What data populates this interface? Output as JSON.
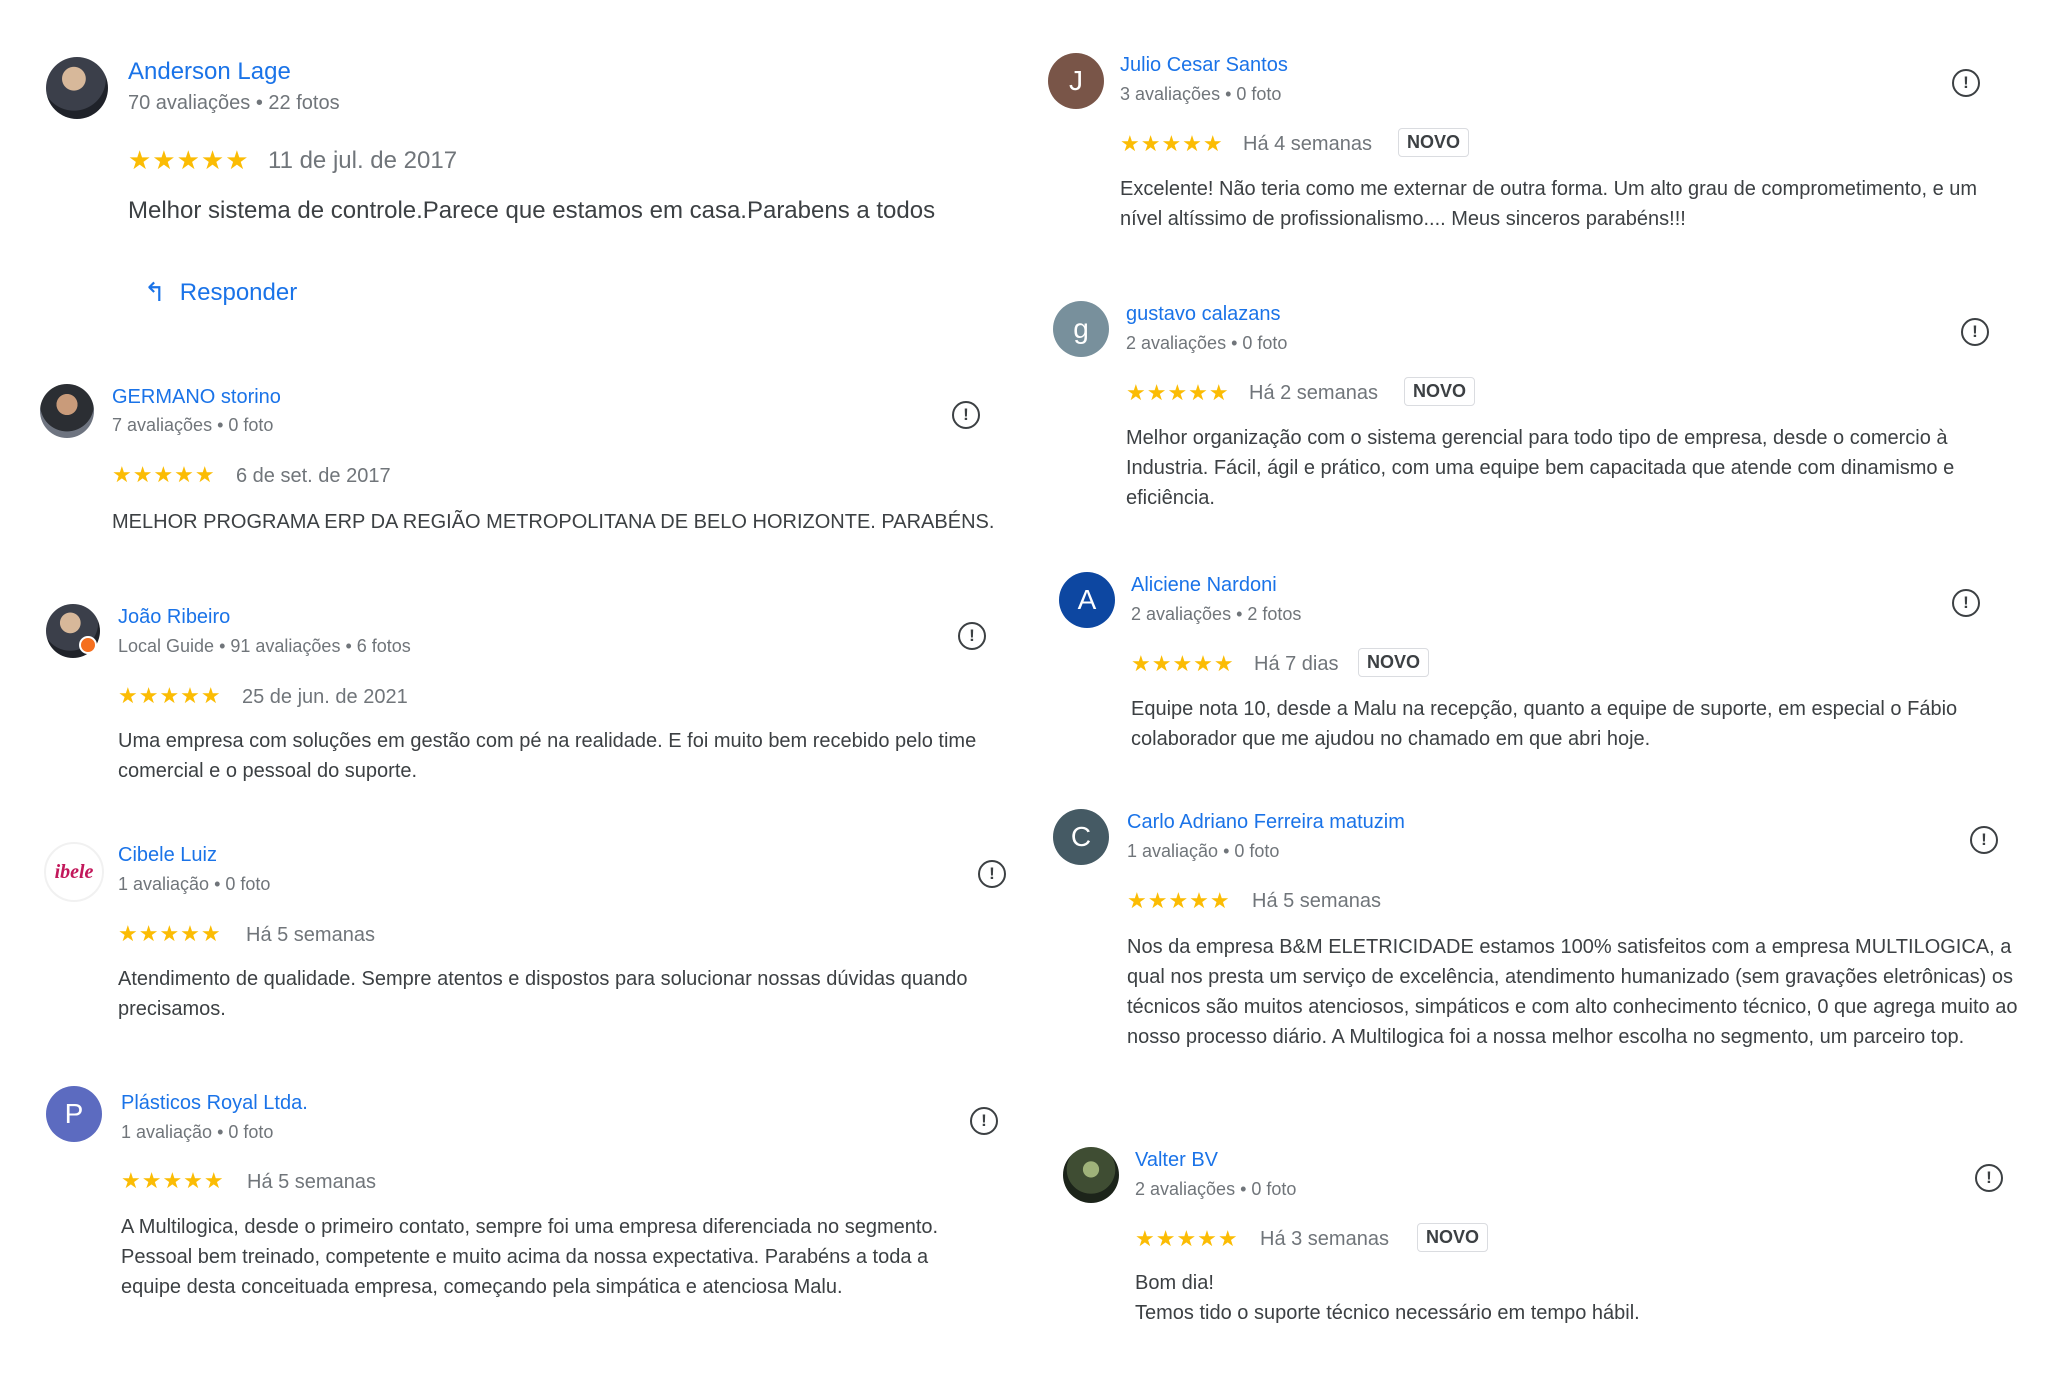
{
  "reviews_left": [
    {
      "name": "Anderson Lage",
      "meta": "70 avaliações • 22 fotos",
      "stars": "★★★★★",
      "date": "11 de jul. de 2017",
      "text": "Melhor sistema de controle.Parece que estamos em casa.Parabens a todos",
      "reply_label": "Responder",
      "reply_icon": "reply-arrow-icon"
    },
    {
      "name": "GERMANO storino",
      "meta": "7 avaliações • 0 foto",
      "stars": "★★★★★",
      "date": "6 de set. de 2017",
      "text": "MELHOR PROGRAMA ERP DA REGIÃO METROPOLITANA DE BELO HORIZONTE. PARABÉNS."
    },
    {
      "name": "João Ribeiro",
      "meta": "Local Guide • 91 avaliações • 6 fotos",
      "stars": "★★★★★",
      "date": "25 de jun. de 2021",
      "text": "Uma empresa com soluções em gestão com pé na realidade. E foi muito bem recebido pelo time comercial e o pessoal do suporte."
    },
    {
      "name": "Cibele Luiz",
      "meta": "1 avaliação • 0 foto",
      "stars": "★★★★★",
      "date": "Há 5 semanas",
      "text": "Atendimento de qualidade. Sempre atentos e dispostos para solucionar nossas dúvidas quando precisamos.",
      "avatar_text": "ibele"
    },
    {
      "name": "Plásticos Royal Ltda.",
      "meta": "1 avaliação • 0 foto",
      "stars": "★★★★★",
      "date": "Há 5 semanas",
      "text": "A Multilogica, desde o primeiro contato, sempre foi uma empresa diferenciada no segmento. Pessoal bem treinado, competente e muito acima da nossa expectativa. Parabéns a toda a equipe desta conceituada empresa, começando pela simpática e atenciosa Malu.",
      "avatar_letter": "P"
    }
  ],
  "reviews_right": [
    {
      "name": "Julio Cesar Santos",
      "meta": "3 avaliações • 0 foto",
      "stars": "★★★★★",
      "date": "Há 4 semanas",
      "badge": "NOVO",
      "text": "Excelente! Não teria como me externar de outra forma. Um alto grau de comprometimento, e um nível altíssimo de profissionalismo.... Meus sinceros parabéns!!!",
      "avatar_letter": "J"
    },
    {
      "name": "gustavo calazans",
      "meta": "2 avaliações • 0 foto",
      "stars": "★★★★★",
      "date": "Há 2 semanas",
      "badge": "NOVO",
      "text": "Melhor organização com o sistema gerencial para todo tipo de empresa, desde o comercio à Industria. Fácil, ágil e prático, com uma equipe bem capacitada que atende com dinamismo e eficiência.",
      "avatar_letter": "g"
    },
    {
      "name": "Aliciene Nardoni",
      "meta": "2 avaliações • 2 fotos",
      "stars": "★★★★★",
      "date": "Há 7 dias",
      "badge": "NOVO",
      "text": "Equipe nota 10, desde a Malu na recepção, quanto a equipe de suporte, em especial o Fábio colaborador que me ajudou no chamado em que abri hoje.",
      "avatar_letter": "A"
    },
    {
      "name": "Carlo Adriano Ferreira matuzim",
      "meta": "1 avaliação • 0 foto",
      "stars": "★★★★★",
      "date": "Há 5 semanas",
      "text": "Nos da empresa B&M ELETRICIDADE estamos 100% satisfeitos com a empresa MULTILOGICA, a qual nos presta um serviço de excelência, atendimento humanizado (sem gravações eletrônicas) os técnicos são muitos atenciosos, simpáticos e com alto conhecimento técnico, 0 que agrega muito ao nosso processo diário. A Multilogica foi a nossa melhor escolha no segmento, um parceiro top.",
      "avatar_letter": "C"
    },
    {
      "name": "Valter BV",
      "meta": "2 avaliações • 0 foto",
      "stars": "★★★★★",
      "date": "Há 3 semanas",
      "badge": "NOVO",
      "text_line1": "Bom dia!",
      "text_line2": "Temos tido o suporte técnico necessário em tempo hábil."
    }
  ],
  "flag_glyph": "!",
  "colors": {
    "link": "#1a73e8",
    "star": "#fbbc04",
    "muted": "#70757a",
    "text": "#3c4043"
  }
}
